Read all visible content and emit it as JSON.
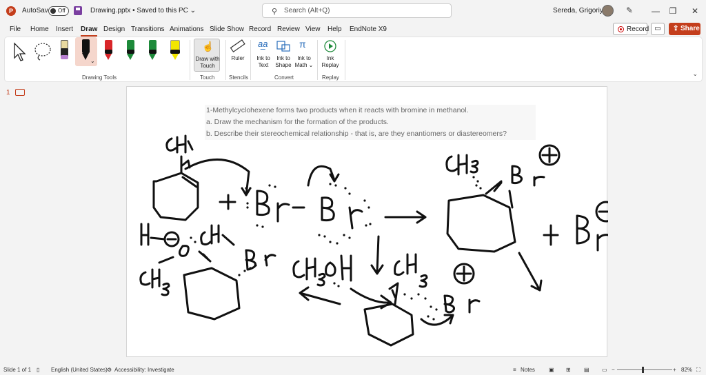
{
  "titlebar": {
    "app_icon_letter": "P",
    "autosave_label": "AutoSave",
    "autosave_state": "Off",
    "doc_title": "Drawing.pptx • Saved to this PC ⌄",
    "search_placeholder": "Search (Alt+Q)",
    "user_name": "Sereda, Grigoriy A",
    "minimize": "—",
    "restore": "❐",
    "close": "✕"
  },
  "menu": {
    "tabs": [
      "File",
      "Home",
      "Insert",
      "Draw",
      "Design",
      "Transitions",
      "Animations",
      "Slide Show",
      "Record",
      "Review",
      "View",
      "Help",
      "EndNote X9"
    ],
    "active_tab": "Draw",
    "record_label": "Record",
    "share_label": "Share"
  },
  "ribbon": {
    "groups": {
      "drawing_tools": "Drawing Tools",
      "touch": "Touch",
      "stencils": "Stencils",
      "convert": "Convert",
      "replay": "Replay"
    },
    "buttons": {
      "draw_with_touch_1": "Draw with",
      "draw_with_touch_2": "Touch",
      "ruler": "Ruler",
      "ink_to_text_1": "Ink to",
      "ink_to_text_2": "Text",
      "ink_to_shape_1": "Ink to",
      "ink_to_shape_2": "Shape",
      "ink_to_math_1": "Ink to",
      "ink_to_math_2": "Math ⌄",
      "ink_replay_1": "Ink",
      "ink_replay_2": "Replay"
    },
    "pens": [
      {
        "color": "#222222",
        "accent": "#9b59b6"
      },
      {
        "color": "#111111",
        "accent": "#111111"
      },
      {
        "color": "#d9262a",
        "accent": "#111111"
      },
      {
        "color": "#1d8a3a",
        "accent": "#111111"
      },
      {
        "color": "#1d8a3a",
        "accent": "#111111"
      },
      {
        "color": "#f2e600",
        "accent": "#111111"
      }
    ]
  },
  "slide_panel": {
    "slide_number": "1"
  },
  "slide": {
    "question_line1": "1-Methylcyclohexene forms two products when it reacts with bromine in methanol.",
    "question_line2": "a. Draw the mechanism for the formation of the products.",
    "question_line3": "b. Describe their stereochemical relationship - that is, are they enantiomers or diastereomers?"
  },
  "statusbar": {
    "slide_of": "Slide 1 of 1",
    "language": "English (United States)",
    "accessibility": "Accessibility: Investigate",
    "notes": "Notes",
    "zoom_minus": "−",
    "zoom_plus": "+",
    "zoom": "82%"
  },
  "colors": {
    "accent": "#c43e1c"
  }
}
